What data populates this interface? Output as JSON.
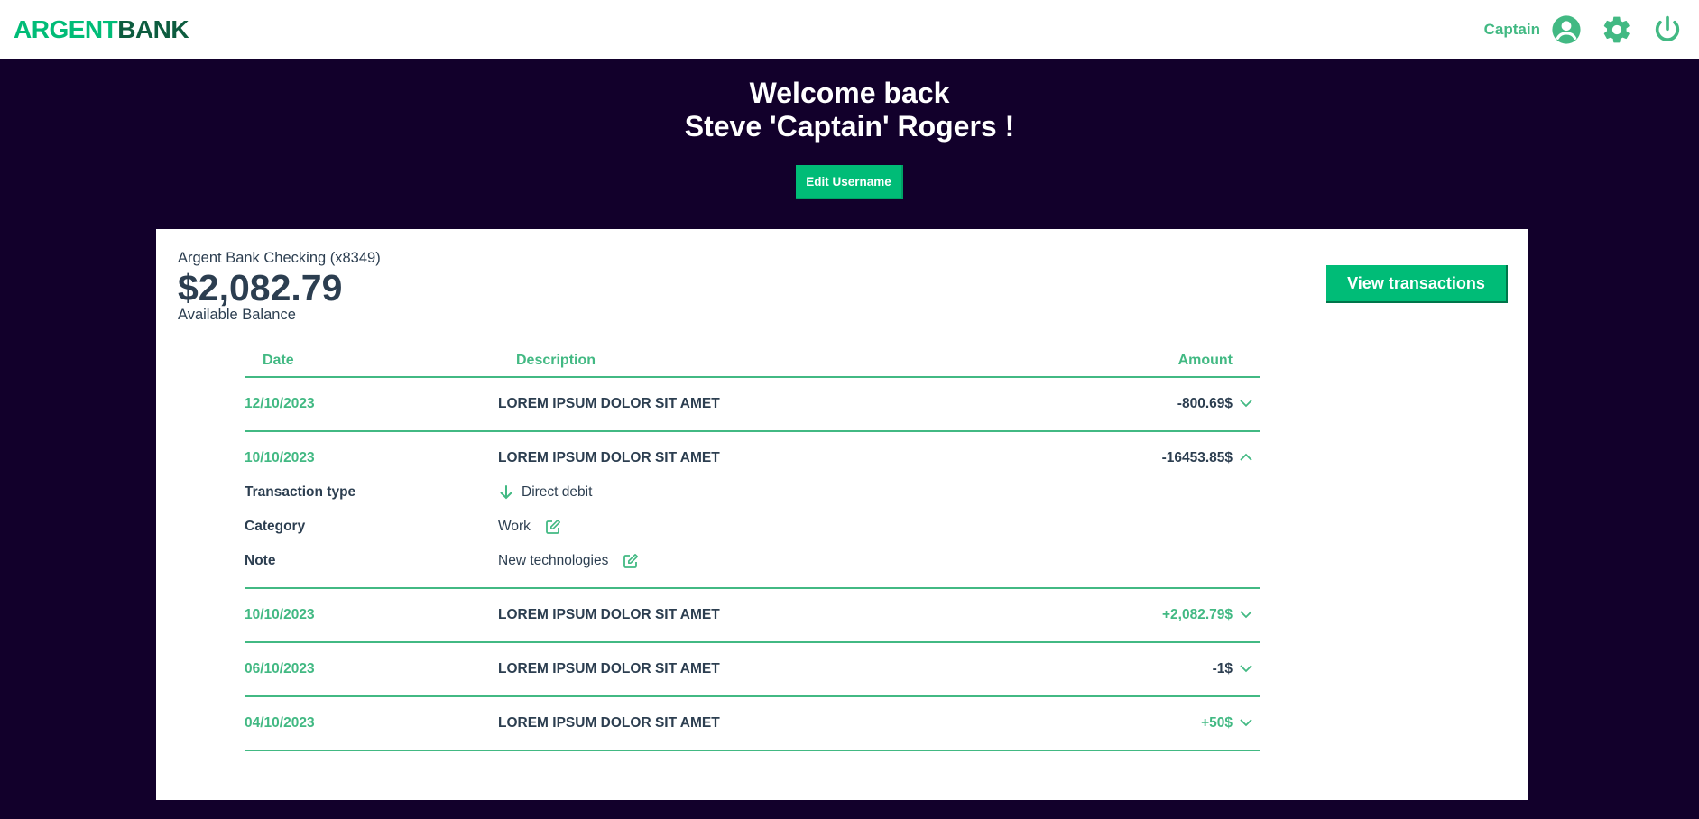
{
  "brand": {
    "part1": "ARGENT",
    "part2": "BANK"
  },
  "nav": {
    "username": "Captain"
  },
  "hero": {
    "line1": "Welcome back",
    "line2": "Steve 'Captain' Rogers !",
    "edit_button": "Edit Username"
  },
  "account": {
    "title": "Argent Bank Checking (x8349)",
    "amount": "$2,082.79",
    "description": "Available Balance",
    "view_button": "View transactions"
  },
  "table": {
    "headers": {
      "date": "Date",
      "description": "Description",
      "amount": "Amount"
    },
    "rows": [
      {
        "date": "12/10/2023",
        "description": "LOREM IPSUM DOLOR SIT AMET",
        "amount": "-800.69$"
      },
      {
        "date": "10/10/2023",
        "description": "LOREM IPSUM DOLOR SIT AMET",
        "amount": "-16453.85$"
      },
      {
        "date": "10/10/2023",
        "description": "LOREM IPSUM DOLOR SIT AMET",
        "amount": "+2,082.79$"
      },
      {
        "date": "06/10/2023",
        "description": "LOREM IPSUM DOLOR SIT AMET",
        "amount": "-1$"
      },
      {
        "date": "04/10/2023",
        "description": "LOREM IPSUM DOLOR SIT AMET",
        "amount": "+50$"
      }
    ],
    "details": {
      "type_label": "Transaction type",
      "type_value": "Direct debit",
      "category_label": "Category",
      "category_value": "Work",
      "note_label": "Note",
      "note_value": "New technologies"
    }
  },
  "colors": {
    "accent": "#00bc77",
    "text_green": "#42b983",
    "dark_bg": "#12002b",
    "text_dark": "#2c3e50"
  },
  "icons": [
    "user-circle-icon",
    "gear-icon",
    "power-icon",
    "chevron-down-icon",
    "chevron-up-icon",
    "arrow-down-icon",
    "edit-icon"
  ]
}
